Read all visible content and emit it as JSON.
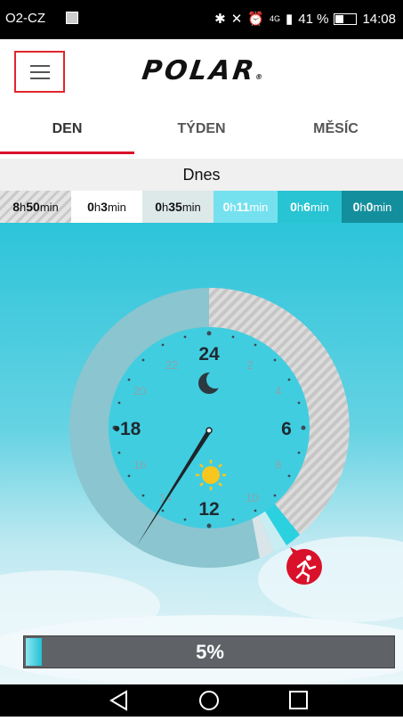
{
  "status_bar": {
    "carrier": "O2-CZ",
    "battery": "41 %",
    "time": "14:08",
    "signal": "4G"
  },
  "header": {
    "menu_icon": "hamburger-menu-icon",
    "logo": "POLAR",
    "logo_mark": "®"
  },
  "tabs": [
    {
      "label": "DEN",
      "active": true
    },
    {
      "label": "TÝDEN",
      "active": false
    },
    {
      "label": "MĚSÍC",
      "active": false
    }
  ],
  "date_label": "Dnes",
  "activity_stats": [
    {
      "h": "8",
      "m": "50",
      "level": "sleep"
    },
    {
      "h": "0",
      "m": "3",
      "level": "sitting"
    },
    {
      "h": "0",
      "m": "35",
      "level": "low"
    },
    {
      "h": "0",
      "m": "11",
      "level": "medium"
    },
    {
      "h": "0",
      "m": "6",
      "level": "high"
    },
    {
      "h": "0",
      "m": "0",
      "level": "very-high"
    }
  ],
  "stat_units": {
    "h": "h",
    "m": "min"
  },
  "clock": {
    "major_hours": [
      "24",
      "6",
      "12",
      "•18"
    ],
    "minor_hours": [
      "22",
      "2",
      "20",
      "4",
      "16",
      "8",
      "14",
      "10"
    ],
    "icons": [
      "moon-icon",
      "sun-icon",
      "running-person-icon"
    ]
  },
  "progress": {
    "label": "5%",
    "value": 0.05
  },
  "colors": {
    "accent": "#d9112a",
    "scene_top": "#2dc4da",
    "nav_bar": "#000000"
  }
}
